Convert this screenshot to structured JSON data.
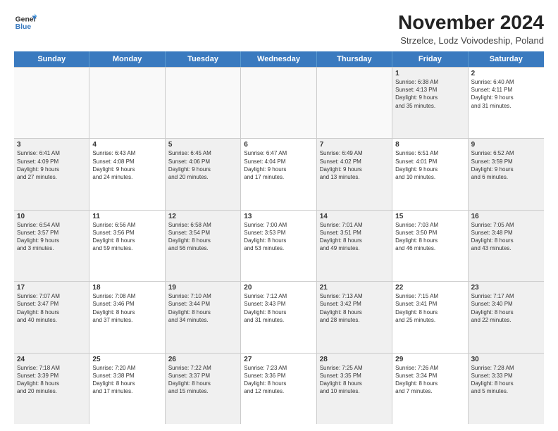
{
  "logo": {
    "text_line1": "General",
    "text_line2": "Blue"
  },
  "title": "November 2024",
  "subtitle": "Strzelce, Lodz Voivodeship, Poland",
  "days_of_week": [
    "Sunday",
    "Monday",
    "Tuesday",
    "Wednesday",
    "Thursday",
    "Friday",
    "Saturday"
  ],
  "weeks": [
    [
      {
        "day": "",
        "empty": true
      },
      {
        "day": "",
        "empty": true
      },
      {
        "day": "",
        "empty": true
      },
      {
        "day": "",
        "empty": true
      },
      {
        "day": "",
        "empty": true
      },
      {
        "day": "1",
        "shaded": true,
        "lines": [
          "Sunrise: 6:38 AM",
          "Sunset: 4:13 PM",
          "Daylight: 9 hours",
          "and 35 minutes."
        ]
      },
      {
        "day": "2",
        "lines": [
          "Sunrise: 6:40 AM",
          "Sunset: 4:11 PM",
          "Daylight: 9 hours",
          "and 31 minutes."
        ]
      }
    ],
    [
      {
        "day": "3",
        "shaded": true,
        "lines": [
          "Sunrise: 6:41 AM",
          "Sunset: 4:09 PM",
          "Daylight: 9 hours",
          "and 27 minutes."
        ]
      },
      {
        "day": "4",
        "lines": [
          "Sunrise: 6:43 AM",
          "Sunset: 4:08 PM",
          "Daylight: 9 hours",
          "and 24 minutes."
        ]
      },
      {
        "day": "5",
        "shaded": true,
        "lines": [
          "Sunrise: 6:45 AM",
          "Sunset: 4:06 PM",
          "Daylight: 9 hours",
          "and 20 minutes."
        ]
      },
      {
        "day": "6",
        "lines": [
          "Sunrise: 6:47 AM",
          "Sunset: 4:04 PM",
          "Daylight: 9 hours",
          "and 17 minutes."
        ]
      },
      {
        "day": "7",
        "shaded": true,
        "lines": [
          "Sunrise: 6:49 AM",
          "Sunset: 4:02 PM",
          "Daylight: 9 hours",
          "and 13 minutes."
        ]
      },
      {
        "day": "8",
        "lines": [
          "Sunrise: 6:51 AM",
          "Sunset: 4:01 PM",
          "Daylight: 9 hours",
          "and 10 minutes."
        ]
      },
      {
        "day": "9",
        "shaded": true,
        "lines": [
          "Sunrise: 6:52 AM",
          "Sunset: 3:59 PM",
          "Daylight: 9 hours",
          "and 6 minutes."
        ]
      }
    ],
    [
      {
        "day": "10",
        "shaded": true,
        "lines": [
          "Sunrise: 6:54 AM",
          "Sunset: 3:57 PM",
          "Daylight: 9 hours",
          "and 3 minutes."
        ]
      },
      {
        "day": "11",
        "lines": [
          "Sunrise: 6:56 AM",
          "Sunset: 3:56 PM",
          "Daylight: 8 hours",
          "and 59 minutes."
        ]
      },
      {
        "day": "12",
        "shaded": true,
        "lines": [
          "Sunrise: 6:58 AM",
          "Sunset: 3:54 PM",
          "Daylight: 8 hours",
          "and 56 minutes."
        ]
      },
      {
        "day": "13",
        "lines": [
          "Sunrise: 7:00 AM",
          "Sunset: 3:53 PM",
          "Daylight: 8 hours",
          "and 53 minutes."
        ]
      },
      {
        "day": "14",
        "shaded": true,
        "lines": [
          "Sunrise: 7:01 AM",
          "Sunset: 3:51 PM",
          "Daylight: 8 hours",
          "and 49 minutes."
        ]
      },
      {
        "day": "15",
        "lines": [
          "Sunrise: 7:03 AM",
          "Sunset: 3:50 PM",
          "Daylight: 8 hours",
          "and 46 minutes."
        ]
      },
      {
        "day": "16",
        "shaded": true,
        "lines": [
          "Sunrise: 7:05 AM",
          "Sunset: 3:48 PM",
          "Daylight: 8 hours",
          "and 43 minutes."
        ]
      }
    ],
    [
      {
        "day": "17",
        "shaded": true,
        "lines": [
          "Sunrise: 7:07 AM",
          "Sunset: 3:47 PM",
          "Daylight: 8 hours",
          "and 40 minutes."
        ]
      },
      {
        "day": "18",
        "lines": [
          "Sunrise: 7:08 AM",
          "Sunset: 3:46 PM",
          "Daylight: 8 hours",
          "and 37 minutes."
        ]
      },
      {
        "day": "19",
        "shaded": true,
        "lines": [
          "Sunrise: 7:10 AM",
          "Sunset: 3:44 PM",
          "Daylight: 8 hours",
          "and 34 minutes."
        ]
      },
      {
        "day": "20",
        "lines": [
          "Sunrise: 7:12 AM",
          "Sunset: 3:43 PM",
          "Daylight: 8 hours",
          "and 31 minutes."
        ]
      },
      {
        "day": "21",
        "shaded": true,
        "lines": [
          "Sunrise: 7:13 AM",
          "Sunset: 3:42 PM",
          "Daylight: 8 hours",
          "and 28 minutes."
        ]
      },
      {
        "day": "22",
        "lines": [
          "Sunrise: 7:15 AM",
          "Sunset: 3:41 PM",
          "Daylight: 8 hours",
          "and 25 minutes."
        ]
      },
      {
        "day": "23",
        "shaded": true,
        "lines": [
          "Sunrise: 7:17 AM",
          "Sunset: 3:40 PM",
          "Daylight: 8 hours",
          "and 22 minutes."
        ]
      }
    ],
    [
      {
        "day": "24",
        "shaded": true,
        "lines": [
          "Sunrise: 7:18 AM",
          "Sunset: 3:39 PM",
          "Daylight: 8 hours",
          "and 20 minutes."
        ]
      },
      {
        "day": "25",
        "lines": [
          "Sunrise: 7:20 AM",
          "Sunset: 3:38 PM",
          "Daylight: 8 hours",
          "and 17 minutes."
        ]
      },
      {
        "day": "26",
        "shaded": true,
        "lines": [
          "Sunrise: 7:22 AM",
          "Sunset: 3:37 PM",
          "Daylight: 8 hours",
          "and 15 minutes."
        ]
      },
      {
        "day": "27",
        "lines": [
          "Sunrise: 7:23 AM",
          "Sunset: 3:36 PM",
          "Daylight: 8 hours",
          "and 12 minutes."
        ]
      },
      {
        "day": "28",
        "shaded": true,
        "lines": [
          "Sunrise: 7:25 AM",
          "Sunset: 3:35 PM",
          "Daylight: 8 hours",
          "and 10 minutes."
        ]
      },
      {
        "day": "29",
        "lines": [
          "Sunrise: 7:26 AM",
          "Sunset: 3:34 PM",
          "Daylight: 8 hours",
          "and 7 minutes."
        ]
      },
      {
        "day": "30",
        "shaded": true,
        "lines": [
          "Sunrise: 7:28 AM",
          "Sunset: 3:33 PM",
          "Daylight: 8 hours",
          "and 5 minutes."
        ]
      }
    ]
  ]
}
